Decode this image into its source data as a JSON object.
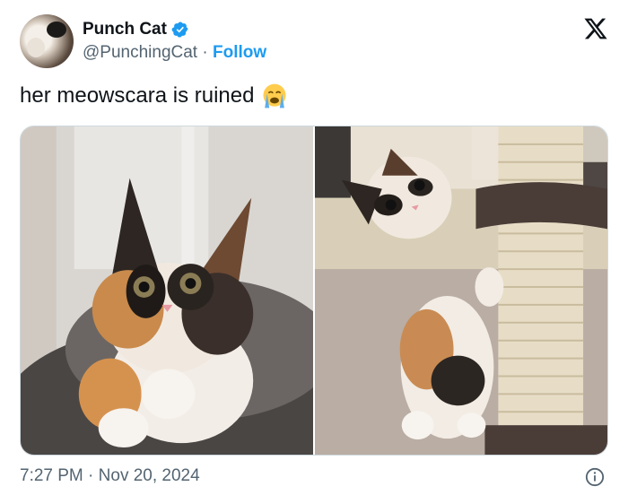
{
  "author": {
    "name": "Punch Cat",
    "handle": "@PunchingCat",
    "separator": "·",
    "follow_label": "Follow",
    "verified_icon": "verified-badge-icon",
    "avatar_icon": "calico-cat-avatar"
  },
  "tweet": {
    "text": "her meowscara is ruined",
    "emoji": "loudly-crying-face-icon"
  },
  "media": {
    "count": 2,
    "photos": [
      {
        "subject": "calico kitten lying in cat bed"
      },
      {
        "subject": "calico kitten standing beside scratching post"
      }
    ]
  },
  "meta": {
    "time": "7:27 PM",
    "separator": "·",
    "date": "Nov 20, 2024"
  },
  "colors": {
    "accent": "#1d9bf0",
    "text": "#0f1419",
    "muted": "#536471",
    "border": "#cfd9de"
  }
}
